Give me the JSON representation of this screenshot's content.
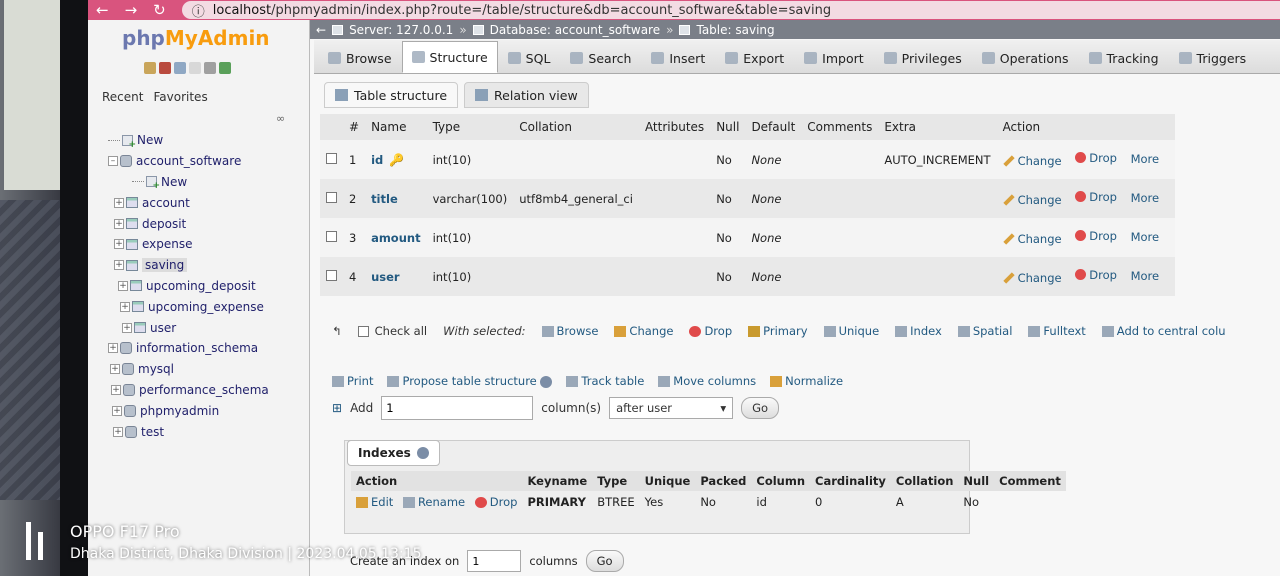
{
  "browser": {
    "url_host": "localhost",
    "url_path": "/phpmyadmin/index.php?route=/table/structure&db=account_software&table=saving"
  },
  "sidebar": {
    "logo_php": "php",
    "logo_myadmin": "MyAdmin",
    "tabs": [
      "Recent",
      "Favorites"
    ],
    "tree": {
      "new_root": "New",
      "db_account_software": "account_software",
      "new_table": "New",
      "tables": [
        "account",
        "deposit",
        "expense",
        "saving",
        "upcoming_deposit",
        "upcoming_expense",
        "user"
      ],
      "other_dbs": [
        "information_schema",
        "mysql",
        "performance_schema",
        "phpmyadmin",
        "test"
      ]
    }
  },
  "breadcrumb": {
    "server": "Server: 127.0.0.1",
    "database": "Database: account_software",
    "table": "Table: saving"
  },
  "tabs": [
    "Browse",
    "Structure",
    "SQL",
    "Search",
    "Insert",
    "Export",
    "Import",
    "Privileges",
    "Operations",
    "Tracking",
    "Triggers"
  ],
  "subtabs": [
    "Table structure",
    "Relation view"
  ],
  "structure": {
    "headers": [
      "#",
      "Name",
      "Type",
      "Collation",
      "Attributes",
      "Null",
      "Default",
      "Comments",
      "Extra",
      "Action"
    ],
    "rows": [
      {
        "num": "1",
        "name": "id",
        "type": "int(10)",
        "collation": "",
        "attributes": "",
        "null": "No",
        "default": "None",
        "comments": "",
        "extra": "AUTO_INCREMENT"
      },
      {
        "num": "2",
        "name": "title",
        "type": "varchar(100)",
        "collation": "utf8mb4_general_ci",
        "attributes": "",
        "null": "No",
        "default": "None",
        "comments": "",
        "extra": ""
      },
      {
        "num": "3",
        "name": "amount",
        "type": "int(10)",
        "collation": "",
        "attributes": "",
        "null": "No",
        "default": "None",
        "comments": "",
        "extra": ""
      },
      {
        "num": "4",
        "name": "user",
        "type": "int(10)",
        "collation": "",
        "attributes": "",
        "null": "No",
        "default": "None",
        "comments": "",
        "extra": ""
      }
    ],
    "actions": {
      "change": "Change",
      "drop": "Drop",
      "more": "More"
    }
  },
  "with_selected": {
    "check_all": "Check all",
    "label": "With selected:",
    "actions": [
      "Browse",
      "Change",
      "Drop",
      "Primary",
      "Unique",
      "Index",
      "Spatial",
      "Fulltext",
      "Add to central colu"
    ]
  },
  "tools": {
    "print": "Print",
    "propose": "Propose table structure",
    "track": "Track table",
    "move": "Move columns",
    "normalize": "Normalize"
  },
  "add_columns": {
    "label": "Add",
    "count": "1",
    "unit": "column(s)",
    "position": "after user",
    "go": "Go"
  },
  "indexes": {
    "title": "Indexes",
    "action_header": "Action",
    "headers": [
      "Keyname",
      "Type",
      "Unique",
      "Packed",
      "Column",
      "Cardinality",
      "Collation",
      "Null",
      "Comment"
    ],
    "row": {
      "edit": "Edit",
      "rename": "Rename",
      "drop": "Drop",
      "keyname": "PRIMARY",
      "type": "BTREE",
      "unique": "Yes",
      "packed": "No",
      "column": "id",
      "cardinality": "0",
      "collation": "A",
      "null": "No",
      "comment": ""
    }
  },
  "create_index": {
    "label": "Create an index on",
    "count": "1",
    "unit": "columns",
    "go": "Go"
  },
  "watermark": {
    "model": "OPPO F17 Pro",
    "location": "Dhaka District, Dhaka Division | 2023.04.05 13:15"
  }
}
